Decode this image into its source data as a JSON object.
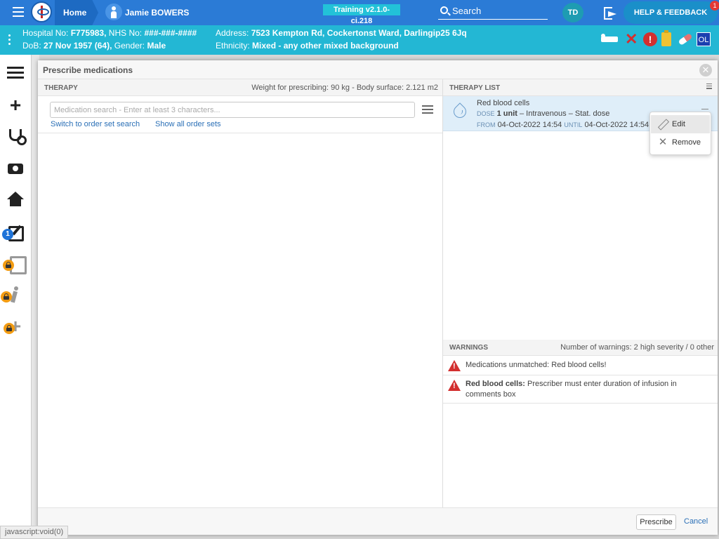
{
  "topbar": {
    "home_label": "Home",
    "patient_name": "Jamie BOWERS",
    "training_badge": "Training v2.1.0-ci.218",
    "search_label": "Search",
    "user_initials": "TD",
    "help_label": "HELP & FEEDBACK",
    "notification_count": "1"
  },
  "banner": {
    "hospital_label": "Hospital No:",
    "hospital_no": "F775983,",
    "nhs_label": "NHS No:",
    "nhs_no": "###-###-####",
    "address_label": "Address:",
    "address": "7523 Kempton Rd, Cockertonst Ward, Darlingip25 6Jq",
    "dob_label": "DoB:",
    "dob": "27 Nov 1957 (64),",
    "gender_label": "Gender:",
    "gender": "Male",
    "ethnicity_label": "Ethnicity:",
    "ethnicity": "Mixed - any other mixed background",
    "ol_label": "OL"
  },
  "sidebar": {
    "edit_badge": "1"
  },
  "modal": {
    "title": "Prescribe medications",
    "therapy": {
      "header": "THERAPY",
      "weight_info": "Weight for prescribing: 90 kg - Body surface: 2.121 m2",
      "search_placeholder": "Medication search - Enter at least 3 characters...",
      "order_set_link": "Switch to order set search",
      "all_order_sets_link": "Show all order sets"
    },
    "therapy_list": {
      "header": "THERAPY LIST",
      "item": {
        "name": "Red blood cells",
        "dose_caption": "DOSE",
        "dose_value": "1 unit",
        "dose_rest": " – Intravenous – Stat. dose",
        "from_caption": "FROM",
        "from_value": "04-Oct-2022 14:54",
        "until_caption": "UNTIL",
        "until_value": "04-Oct-2022 14:54"
      },
      "context_menu": {
        "edit": "Edit",
        "remove": "Remove"
      }
    },
    "warnings": {
      "header": "WARNINGS",
      "summary": "Number of warnings: 2 high severity / 0 other",
      "items": [
        {
          "bold": "",
          "text": "Medications unmatched: Red blood cells!"
        },
        {
          "bold": "Red blood cells:",
          "text": " Prescriber must enter duration of infusion in comments box"
        }
      ]
    },
    "footer": {
      "prescribe": "Prescribe",
      "cancel": "Cancel"
    }
  },
  "status_bar": "javascript:void(0)"
}
